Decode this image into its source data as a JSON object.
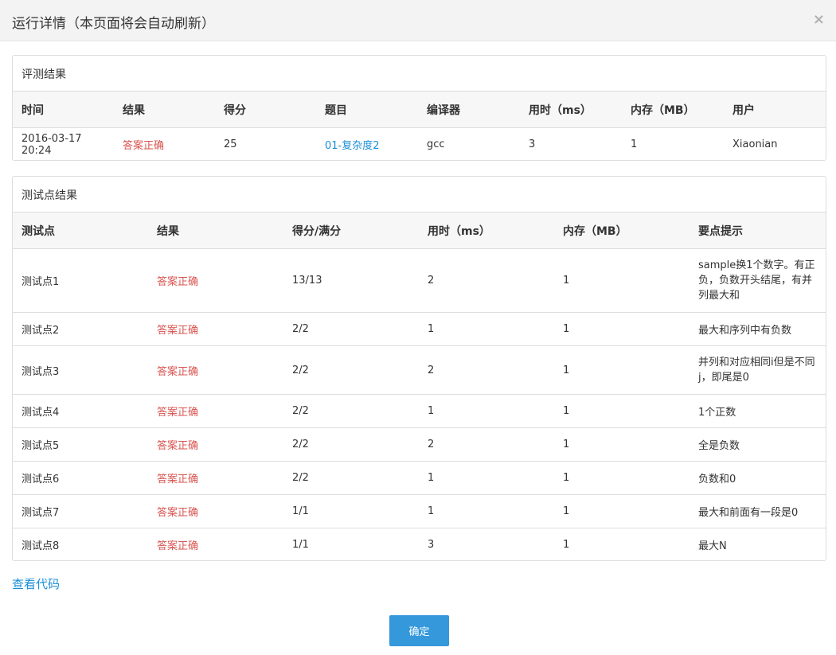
{
  "modal": {
    "title": "运行详情（本页面将会自动刷新）",
    "close_symbol": "×"
  },
  "judge_result": {
    "heading": "评测结果",
    "columns": [
      "时间",
      "结果",
      "得分",
      "题目",
      "编译器",
      "用时（ms）",
      "内存（MB）",
      "用户"
    ],
    "row": {
      "time": "2016-03-17 20:24",
      "result": "答案正确",
      "score": "25",
      "problem": "01-复杂度2",
      "compiler": "gcc",
      "time_ms": "3",
      "memory_mb": "1",
      "user": "Xiaonian"
    }
  },
  "testcase_result": {
    "heading": "测试点结果",
    "columns": [
      "测试点",
      "结果",
      "得分/满分",
      "用时（ms）",
      "内存（MB）",
      "要点提示"
    ],
    "rows": [
      {
        "name": "测试点1",
        "result": "答案正确",
        "score": "13/13",
        "time_ms": "2",
        "memory_mb": "1",
        "hint": "sample换1个数字。有正负，负数开头结尾，有并列最大和"
      },
      {
        "name": "测试点2",
        "result": "答案正确",
        "score": "2/2",
        "time_ms": "1",
        "memory_mb": "1",
        "hint": "最大和序列中有负数"
      },
      {
        "name": "测试点3",
        "result": "答案正确",
        "score": "2/2",
        "time_ms": "2",
        "memory_mb": "1",
        "hint": "并列和对应相同i但是不同j，即尾是0"
      },
      {
        "name": "测试点4",
        "result": "答案正确",
        "score": "2/2",
        "time_ms": "1",
        "memory_mb": "1",
        "hint": "1个正数"
      },
      {
        "name": "测试点5",
        "result": "答案正确",
        "score": "2/2",
        "time_ms": "2",
        "memory_mb": "1",
        "hint": "全是负数"
      },
      {
        "name": "测试点6",
        "result": "答案正确",
        "score": "2/2",
        "time_ms": "1",
        "memory_mb": "1",
        "hint": "负数和0"
      },
      {
        "name": "测试点7",
        "result": "答案正确",
        "score": "1/1",
        "time_ms": "1",
        "memory_mb": "1",
        "hint": "最大和前面有一段是0"
      },
      {
        "name": "测试点8",
        "result": "答案正确",
        "score": "1/1",
        "time_ms": "3",
        "memory_mb": "1",
        "hint": "最大N"
      }
    ]
  },
  "footer": {
    "view_code_label": "查看代码",
    "ok_label": "确定"
  },
  "colors": {
    "accept": "#d9534f",
    "link": "#1b8fd6",
    "primary_button": "#3498db"
  }
}
